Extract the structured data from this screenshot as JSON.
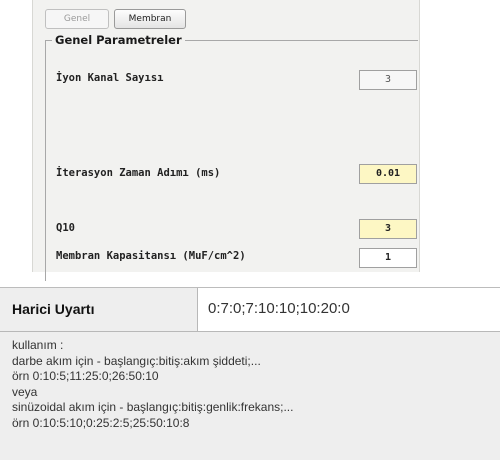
{
  "tabs": {
    "genel": "Genel",
    "membran": "Membran"
  },
  "group": {
    "title": "Genel Parametreler"
  },
  "params": {
    "iyon_kanal_sayisi": {
      "label": "İyon Kanal Sayısı",
      "value": "3"
    },
    "iterasyon_zaman_adimi": {
      "label": "İterasyon Zaman Adımı (ms)",
      "value": "0.01"
    },
    "q10": {
      "label": "Q10",
      "value": "3"
    },
    "membran_kapasitansi": {
      "label": "Membran Kapasitansı (MuF/cm^2)",
      "value": "1"
    }
  },
  "harici": {
    "label": "Harici Uyartı",
    "value": "0:7:0;7:10:10;10:20:0",
    "help": [
      "kullanım :",
      "darbe akım için - başlangıç:bitiş:akım şiddeti;...",
      "örn 0:10:5;11:25:0;26:50:10",
      "veya",
      "sinüzoidal akım için - başlangıç:bitiş:genlik:frekans;...",
      "örn 0:10:5:10;0:25:2:5;25:50:10:8"
    ]
  },
  "colors": {
    "panel_bg": "#f2f2f0",
    "highlight_input": "#fdf7c4",
    "harici_bg": "#eeeeee"
  }
}
